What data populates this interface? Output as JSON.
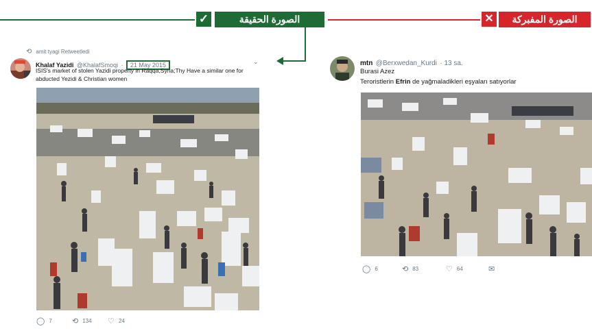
{
  "banner": {
    "real_label": "الصورة الحقيقة",
    "fake_label": "الصورة المفبركة",
    "colors": {
      "real": "#1e6b35",
      "fake": "#d7262b"
    }
  },
  "tweet_left": {
    "retweet_by": "amit tyagi Retweetledi",
    "name": "Khalaf Yazidi",
    "handle": "@KhalafSmoqi",
    "separator": "·",
    "date": "21 May 2015",
    "text_line1": "ISIS's market of stolen Yazidi property in Raqqa,Syria;Thy Have a similar one for",
    "text_line2": "abducted Yezidi & Christian women",
    "replies": "7",
    "retweets": "134",
    "likes": "24"
  },
  "tweet_right": {
    "name": "mtn",
    "handle": "@Berxwedan_Kurdi",
    "time": "· 13 sa.",
    "line1": "Burasi Azez",
    "line2_pre": "Teroristlerin ",
    "line2_bold": "Efrin",
    "line2_post": " de yağmaladikleri eşyaları satıyorlar",
    "replies": "6",
    "retweets": "83",
    "likes": "64"
  }
}
